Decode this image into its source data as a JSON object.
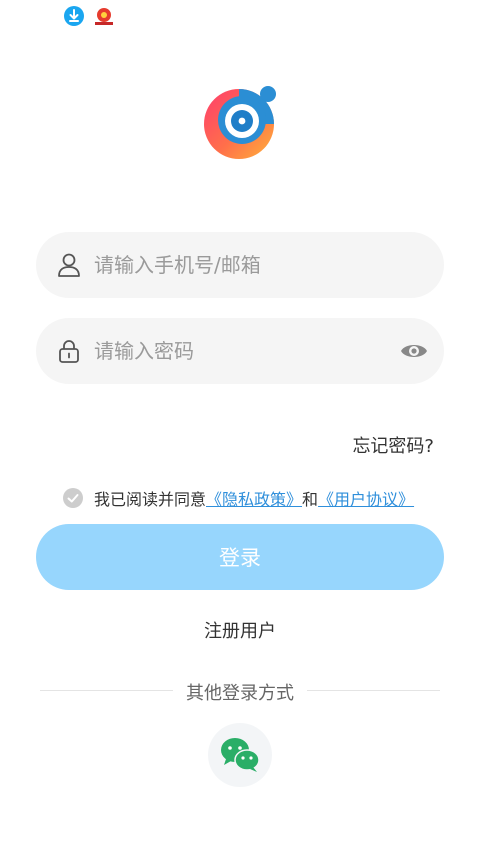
{
  "status_bar": {
    "icons": [
      "download-icon",
      "app-notification-icon"
    ]
  },
  "logo": {
    "name": "app-logo"
  },
  "phone_input": {
    "placeholder": "请输入手机号/邮箱",
    "icon": "user-icon"
  },
  "password_input": {
    "placeholder": "请输入密码",
    "icon": "lock-icon",
    "toggle_icon": "eye-icon"
  },
  "forgot_password": "忘记密码?",
  "agreement": {
    "prefix": "我已阅读并同意",
    "privacy_link": "《隐私政策》",
    "and": "和",
    "terms_link": "《用户协议》",
    "checked": true
  },
  "login_button": "登录",
  "register_link": "注册用户",
  "other_login": {
    "label": "其他登录方式",
    "methods": [
      "wechat-icon"
    ]
  },
  "colors": {
    "primary": "#97d6fd",
    "link": "#2f8fdb",
    "field_bg": "#f5f5f5"
  }
}
